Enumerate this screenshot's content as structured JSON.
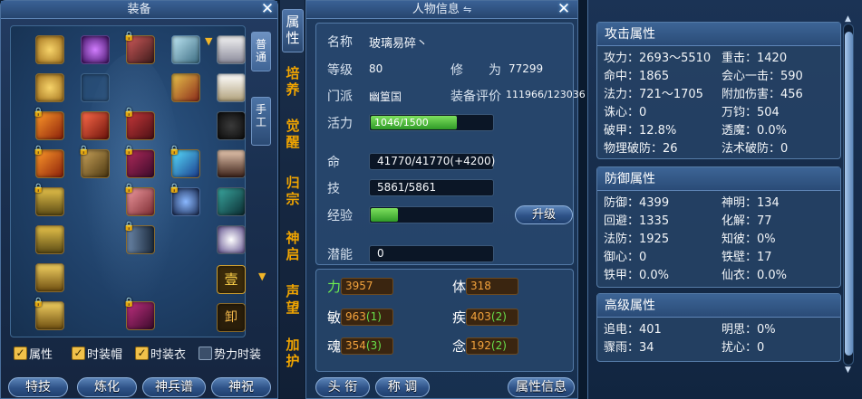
{
  "equipment": {
    "title": "装备",
    "close_icon": "close-icon",
    "side_tabs": [
      "普通",
      "手工"
    ],
    "checkboxes": [
      {
        "label": "属性",
        "checked": true
      },
      {
        "label": "时装帽",
        "checked": true
      },
      {
        "label": "时装衣",
        "checked": true
      },
      {
        "label": "势力时装",
        "checked": false
      }
    ],
    "buttons": [
      "特技",
      "炼化",
      "神兵谱",
      "神祝"
    ],
    "badge_seal": "壹",
    "badge_unequip": "卸"
  },
  "nav_tabs": [
    "属性",
    "培养",
    "觉醒",
    "归宗",
    "神启",
    "声望",
    "加护"
  ],
  "info": {
    "title": "人物信息",
    "name_label": "名称",
    "name_value": "玻璃易碎丶",
    "level_label": "等级",
    "level_value": "80",
    "cultivation_label": "修　　为",
    "cultivation_value": "77299",
    "faction_label": "门派",
    "faction_value": "幽篁国",
    "rating_label": "装备评价",
    "rating_value": "111966/123036",
    "vitality_label": "活力",
    "vitality_value": "1046/1500",
    "vitality_fraction": 0.697,
    "hp_label": "命",
    "hp_value": "41770/41770(+4200)",
    "skill_label": "技",
    "skill_value": "5861/5861",
    "exp_label": "经验",
    "exp_fraction": 0.22,
    "upgrade_button": "升级",
    "potential_label": "潜能",
    "potential_value": "0",
    "attributes": [
      {
        "name": "力",
        "value": "3957",
        "bonus": "",
        "green": true
      },
      {
        "name": "体",
        "value": "318",
        "bonus": "",
        "green": false
      },
      {
        "name": "敏",
        "value": "963",
        "bonus": "(1)",
        "green": false
      },
      {
        "name": "疾",
        "value": "403",
        "bonus": "(2)",
        "green": false
      },
      {
        "name": "魂",
        "value": "354",
        "bonus": "(3)",
        "green": false
      },
      {
        "name": "念",
        "value": "192",
        "bonus": "(2)",
        "green": false
      }
    ],
    "bottom_buttons": [
      "头 衔",
      "称 调",
      "属性信息"
    ]
  },
  "details": {
    "attack": {
      "title": "攻击属性",
      "rows": [
        [
          "攻力：2693～5510",
          "重击：1420"
        ],
        [
          "命中：1865",
          "会心一击：590"
        ],
        [
          "法力：721～1705",
          "附加伤害：456"
        ],
        [
          "诛心：0",
          "万钧：504"
        ],
        [
          "破甲：12.8%",
          "透魔：0.0%"
        ],
        [
          "物理破防：26",
          "法术破防：0"
        ]
      ]
    },
    "defense": {
      "title": "防御属性",
      "rows": [
        [
          "防御：4399",
          "神明：134"
        ],
        [
          "回避：1335",
          "化解：77"
        ],
        [
          "法防：1925",
          "知彼：0%"
        ],
        [
          "御心：0",
          "铁壁：17"
        ],
        [
          "铁甲：0.0%",
          "仙衣：0.0%"
        ]
      ]
    },
    "advanced": {
      "title": "高级属性",
      "rows": [
        [
          "追电：401",
          "明思：0%"
        ],
        [
          "骤雨：34",
          "扰心：0"
        ]
      ]
    }
  }
}
